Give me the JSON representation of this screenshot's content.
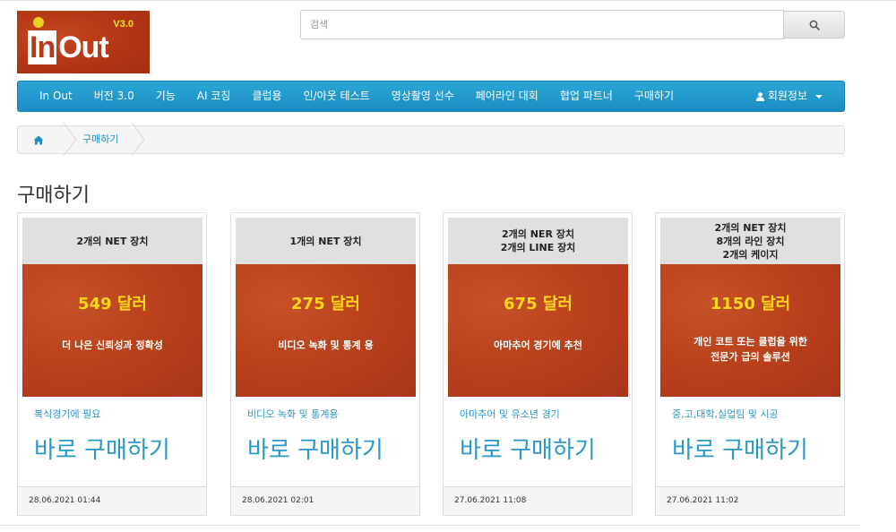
{
  "logo": {
    "version": "V3.0",
    "brand_in": "In",
    "brand_out": "Out"
  },
  "search": {
    "placeholder": "검색"
  },
  "nav": {
    "items": [
      "In Out",
      "버전 3.0",
      "기능",
      "AI 코칭",
      "클럽용",
      "인/아웃 테스트",
      "영상촬영 선수",
      "페어라인 대회",
      "협업 파트너",
      "구매하기"
    ],
    "account_label": "회원정보"
  },
  "breadcrumb": {
    "current": "구매하기"
  },
  "page": {
    "title": "구매하기"
  },
  "cards": [
    {
      "head": [
        "2개의 NET 장치"
      ],
      "price": "549 달러",
      "desc": [
        "더 나은 신뢰성과 정확성"
      ],
      "sub": "복식경기에 필요",
      "cta": "바로 구매하기",
      "date": "28.06.2021 01:44"
    },
    {
      "head": [
        "1개의 NET 장치"
      ],
      "price": "275 달러",
      "desc": [
        "비디오 녹화 및 통계 용"
      ],
      "sub": "비디오 녹화 및 통계용",
      "cta": "바로 구매하기",
      "date": "28.06.2021 02:01"
    },
    {
      "head": [
        "2개의 NER 장치",
        "2개의 LINE 장치"
      ],
      "price": "675 달러",
      "desc": [
        "아마추어 경기에 추천"
      ],
      "sub": "아마추어 및 유소년 경기",
      "cta": "바로 구매하기",
      "date": "27.06.2021 11:08"
    },
    {
      "head": [
        "2개의 NET 장치",
        "8개의 라인 장치",
        "2개의 케이지"
      ],
      "price": "1150 달러",
      "desc": [
        "개인 코트 또는 클럽을 위한",
        "전문가 급의  솔루션"
      ],
      "sub": "중,고,대학,실업팀 및 시공",
      "cta": "바로 구매하기",
      "date": "27.06.2021 11:02"
    }
  ],
  "colors": {
    "nav": "#1a8cc3",
    "link": "#2a97c9",
    "price": "#ffd71a",
    "card_bg": "#b8401c"
  }
}
